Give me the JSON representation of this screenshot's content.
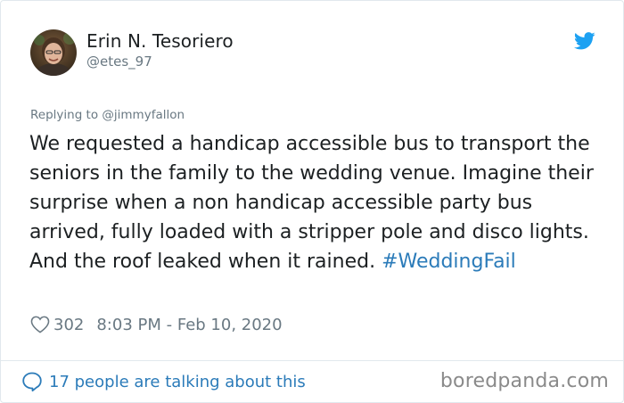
{
  "user": {
    "name": "Erin N. Tesoriero",
    "handle": "@etes_97"
  },
  "tweet": {
    "replying_to": "Replying to @jimmyfallon",
    "text": "We requested a handicap accessible bus to transport the seniors in the family to the wedding venue. Imagine their surprise when a non handicap accessible party bus arrived, fully loaded with a stripper pole and disco lights. And the roof leaked when it rained. ",
    "hashtag": "#WeddingFail",
    "likes": "302",
    "timestamp": "8:03 PM - Feb 10, 2020"
  },
  "footer": {
    "talking": "17 people are talking about this",
    "watermark": "boredpanda.com"
  },
  "colors": {
    "link": "#2b7bb9",
    "twitter_bird": "#1da1f2",
    "text_primary": "#1c2022",
    "text_secondary": "#697882"
  },
  "icons": [
    "avatar",
    "twitter-bird-icon",
    "heart-icon",
    "speech-bubble-icon"
  ]
}
